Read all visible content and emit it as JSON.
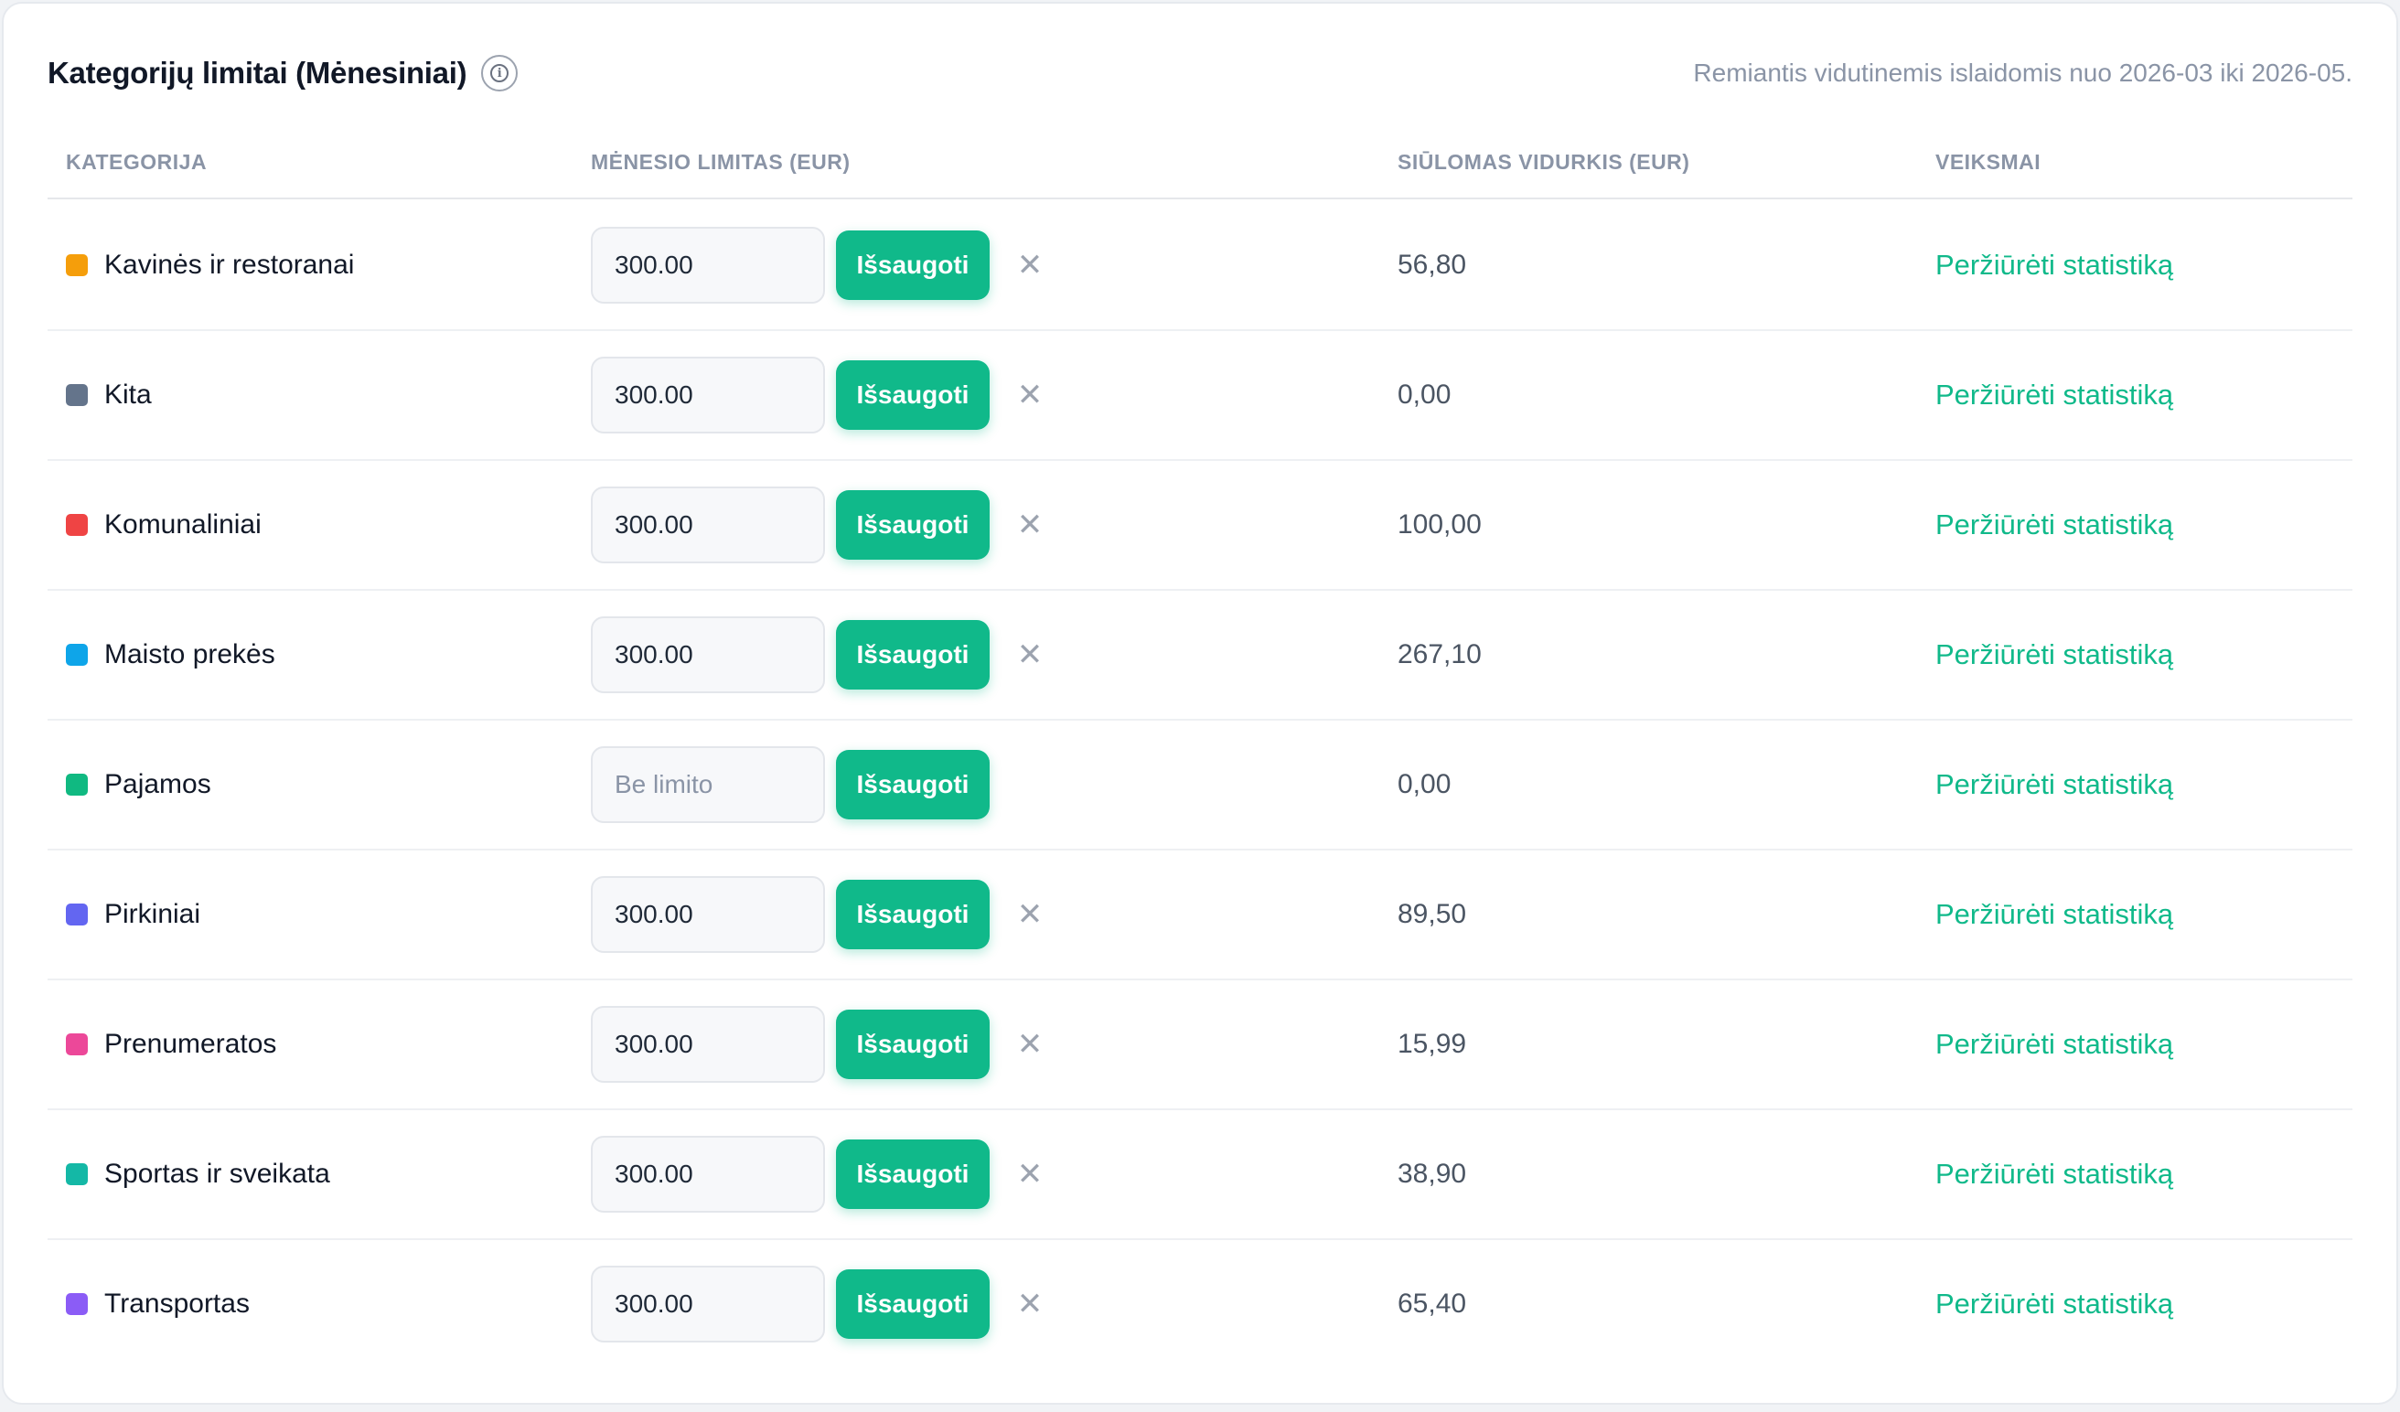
{
  "header": {
    "title": "Kategorijų limitai (Mėnesiniai)",
    "subtitle": "Remiantis vidutinemis islaidomis nuo 2026-03 iki 2026-05."
  },
  "columns": {
    "category": "KATEGORIJA",
    "monthly_limit": "MĖNESIO LIMITAS (EUR)",
    "suggested_avg": "SIŪLOMAS VIDURKIS (EUR)",
    "actions": "VEIKSMAI"
  },
  "save_label": "Išsaugoti",
  "clear_glyph": "✕",
  "action_label": "Peržiūrėti statistiką",
  "limit_placeholder": "Be limito",
  "rows": [
    {
      "name": "Kavinės ir restoranai",
      "color": "#f59e0b",
      "limit": "300.00",
      "avg": "56,80",
      "has_limit": true
    },
    {
      "name": "Kita",
      "color": "#64748b",
      "limit": "300.00",
      "avg": "0,00",
      "has_limit": true
    },
    {
      "name": "Komunaliniai",
      "color": "#ef4444",
      "limit": "300.00",
      "avg": "100,00",
      "has_limit": true
    },
    {
      "name": "Maisto prekės",
      "color": "#0ea5e9",
      "limit": "300.00",
      "avg": "267,10",
      "has_limit": true
    },
    {
      "name": "Pajamos",
      "color": "#10b981",
      "limit": "",
      "avg": "0,00",
      "has_limit": false
    },
    {
      "name": "Pirkiniai",
      "color": "#6366f1",
      "limit": "300.00",
      "avg": "89,50",
      "has_limit": true
    },
    {
      "name": "Prenumeratos",
      "color": "#ec4899",
      "limit": "300.00",
      "avg": "15,99",
      "has_limit": true
    },
    {
      "name": "Sportas ir sveikata",
      "color": "#14b8a6",
      "limit": "300.00",
      "avg": "38,90",
      "has_limit": true
    },
    {
      "name": "Transportas",
      "color": "#8b5cf6",
      "limit": "300.00",
      "avg": "65,40",
      "has_limit": true
    }
  ]
}
